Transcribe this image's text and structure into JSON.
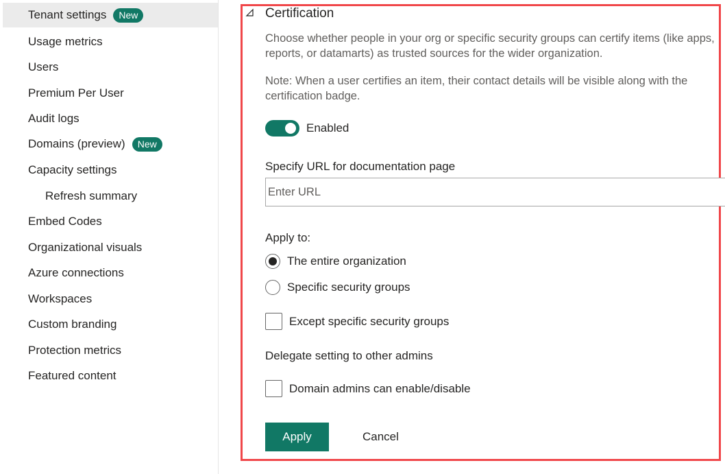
{
  "sidebar": {
    "items": [
      {
        "label": "Tenant settings",
        "badge": "New",
        "active": true
      },
      {
        "label": "Usage metrics"
      },
      {
        "label": "Users"
      },
      {
        "label": "Premium Per User"
      },
      {
        "label": "Audit logs"
      },
      {
        "label": "Domains (preview)",
        "badge": "New"
      },
      {
        "label": "Capacity settings"
      },
      {
        "label": "Refresh summary",
        "sub": true
      },
      {
        "label": "Embed Codes"
      },
      {
        "label": "Organizational visuals"
      },
      {
        "label": "Azure connections"
      },
      {
        "label": "Workspaces"
      },
      {
        "label": "Custom branding"
      },
      {
        "label": "Protection metrics"
      },
      {
        "label": "Featured content"
      }
    ]
  },
  "section": {
    "title": "Certification",
    "collapse_icon": "collapse-triangle-icon",
    "description": "Choose whether people in your org or specific security groups can certify items (like apps, reports, or datamarts) as trusted sources for the wider organization.",
    "note": "Note: When a user certifies an item, their contact details will be visible along with the certification badge.",
    "toggle": {
      "label": "Enabled",
      "on": true
    },
    "url_field": {
      "label": "Specify URL for documentation page",
      "placeholder": "Enter URL",
      "value": ""
    },
    "apply_to": {
      "label": "Apply to:",
      "options": [
        {
          "label": "The entire organization",
          "checked": true
        },
        {
          "label": "Specific security groups",
          "checked": false
        }
      ],
      "except_label": "Except specific security groups",
      "except_checked": false
    },
    "delegate": {
      "label": "Delegate setting to other admins",
      "checkbox_label": "Domain admins can enable/disable",
      "checked": false
    },
    "buttons": {
      "apply": "Apply",
      "cancel": "Cancel"
    }
  },
  "colors": {
    "accent": "#117865",
    "highlight_border": "#f0474a",
    "active_nav_bg": "#ebebeb"
  }
}
